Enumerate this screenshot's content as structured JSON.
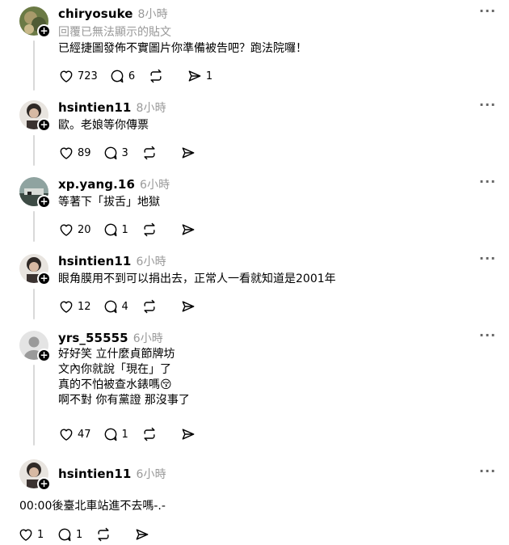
{
  "posts": [
    {
      "username": "chiryosuke",
      "time": "8小時",
      "reply_note": "回覆已無法顯示的貼文",
      "text": "已經捷圖發佈不實圖片你準備被告吧？跑法院囉！",
      "likes": "723",
      "replies": "6",
      "reposts": "",
      "shares": "1",
      "avatar_color": "#8a7b52"
    },
    {
      "username": "hsintien11",
      "time": "8小時",
      "text": "歐。老娘等你傳票",
      "likes": "89",
      "replies": "3",
      "reposts": "",
      "shares": "",
      "avatar_color": "#3a3230"
    },
    {
      "username": "xp.yang.16",
      "time": "6小時",
      "text": "等著下「拔舌」地獄",
      "likes": "20",
      "replies": "1",
      "reposts": "",
      "shares": "",
      "avatar_color": "#5b6f6a"
    },
    {
      "username": "hsintien11",
      "time": "6小時",
      "text": "眼角膜用不到可以捐出去，正常人一看就知道是2001年",
      "likes": "12",
      "replies": "4",
      "reposts": "",
      "shares": "",
      "avatar_color": "#3a3230"
    },
    {
      "username": "yrs_55555",
      "time": "6小時",
      "text": "好好笑 立什麼貞節牌坊\n文內你就說「現在」了\n真的不怕被查水錶嗎😚\n啊不對 你有黨證 那沒事了",
      "likes": "47",
      "replies": "1",
      "reposts": "",
      "shares": "",
      "avatar_color": "#dcdcdc"
    },
    {
      "username": "hsintien11",
      "time": "6小時",
      "text": "00:00後臺北車站進不去嗎-.-",
      "likes": "1",
      "replies": "1",
      "reposts": "",
      "shares": "",
      "avatar_color": "#3a3230"
    }
  ],
  "icons": {
    "more": "more-dots-icon",
    "like": "heart-icon",
    "reply": "comment-bubble-icon",
    "repost": "repost-arrows-icon",
    "share": "send-arrow-icon",
    "follow": "follow-plus-icon"
  }
}
